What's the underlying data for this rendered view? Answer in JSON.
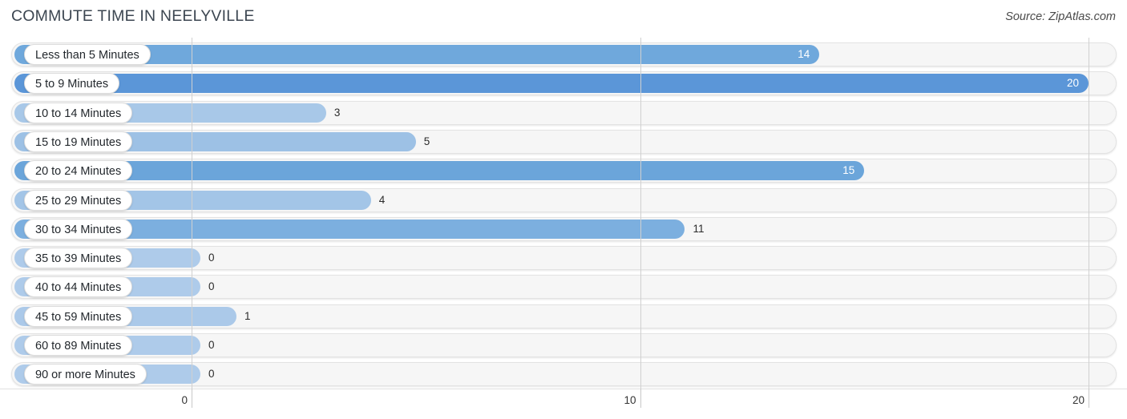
{
  "header": {
    "title": "COMMUTE TIME IN NEELYVILLE",
    "source": "Source: ZipAtlas.com"
  },
  "colors": {
    "background": "#ffffff",
    "title_text": "#3c4651",
    "track_fill": "#f6f6f6",
    "track_border": "#e3e3e3",
    "gridline": "#d0d0d0",
    "label_pill_bg": "#ffffff",
    "value_text_inside": "#ffffff",
    "value_text_outside": "#2b2b2b",
    "bar_high": "#5b96d8",
    "bar_mid": "#6fa8dc",
    "bar_low": "#a8c8e8"
  },
  "chart_data": {
    "type": "bar",
    "orientation": "horizontal",
    "title": "COMMUTE TIME IN NEELYVILLE",
    "xlabel": "",
    "ylabel": "",
    "xlim": [
      0,
      20
    ],
    "grid": true,
    "legend": null,
    "xticks": [
      "0",
      "10",
      "20"
    ],
    "xtick_values": [
      0,
      10,
      20
    ],
    "categories": [
      "Less than 5 Minutes",
      "5 to 9 Minutes",
      "10 to 14 Minutes",
      "15 to 19 Minutes",
      "20 to 24 Minutes",
      "25 to 29 Minutes",
      "30 to 34 Minutes",
      "35 to 39 Minutes",
      "40 to 44 Minutes",
      "45 to 59 Minutes",
      "60 to 89 Minutes",
      "90 or more Minutes"
    ],
    "values": [
      14,
      20,
      3,
      5,
      15,
      4,
      11,
      0,
      0,
      1,
      0,
      0
    ],
    "value_labels": [
      "14",
      "20",
      "3",
      "5",
      "15",
      "4",
      "11",
      "0",
      "0",
      "1",
      "0",
      "0"
    ],
    "bar_colors": [
      "#6fa8dc",
      "#5b96d8",
      "#a8c8e8",
      "#9dc1e5",
      "#6ba5da",
      "#a3c5e7",
      "#7cafdf",
      "#aecbea",
      "#aecbea",
      "#abc9e9",
      "#aecbea",
      "#aecbea"
    ]
  }
}
